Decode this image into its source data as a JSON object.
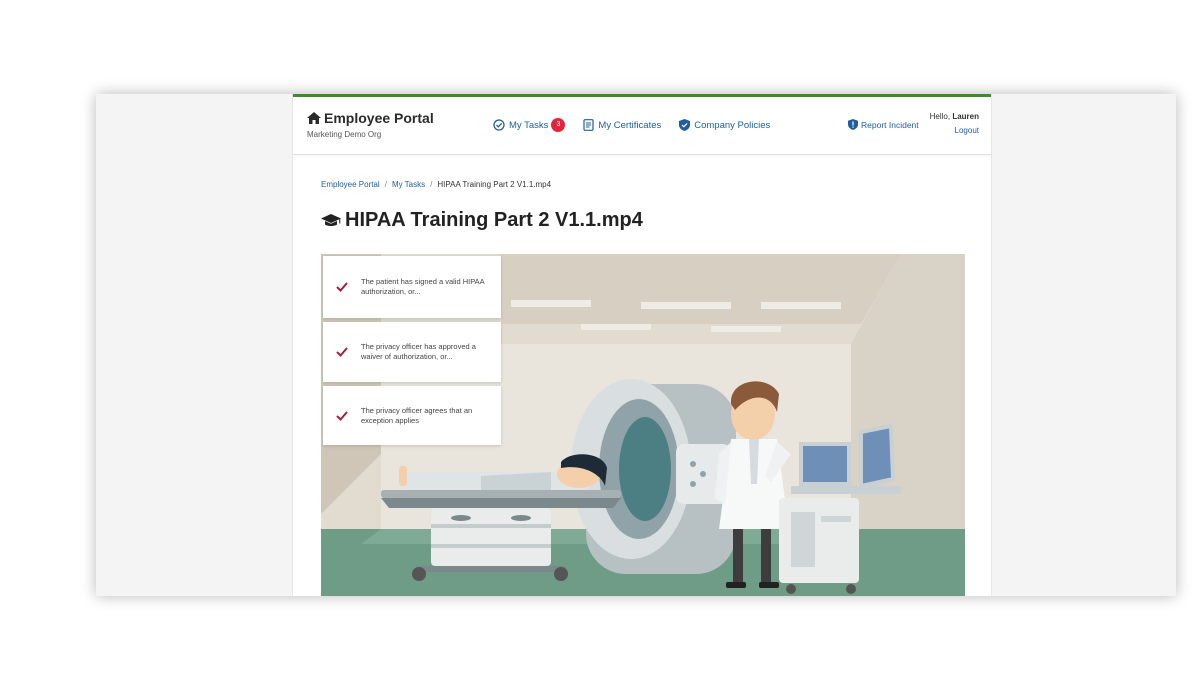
{
  "header": {
    "brand_title": "Employee Portal",
    "brand_subtitle": "Marketing Demo Org",
    "nav": [
      {
        "label": "My Tasks",
        "badge": "3",
        "icon": "check-circle-icon"
      },
      {
        "label": "My Certificates",
        "icon": "document-icon"
      },
      {
        "label": "Company Policies",
        "icon": "shield-check-icon"
      }
    ],
    "report_label": "Report Incident",
    "greeting": "Hello,",
    "user_name": "Lauren",
    "logout_label": "Logout"
  },
  "breadcrumb": {
    "items": [
      "Employee Portal",
      "My Tasks"
    ],
    "current": "HIPAA Training Part 2 V1.1.mp4"
  },
  "page_title": "HIPAA Training Part 2 V1.1.mp4",
  "video": {
    "checklist": [
      "The patient has signed a valid HIPAA authorization, or...",
      "The privacy officer has approved a waiver of authorization, or...",
      "The privacy officer agrees that an exception applies"
    ]
  },
  "colors": {
    "accent_green": "#3f8b2a",
    "link_blue": "#1f5fa0",
    "badge_red": "#e3243b",
    "check_red": "#a3213a"
  }
}
